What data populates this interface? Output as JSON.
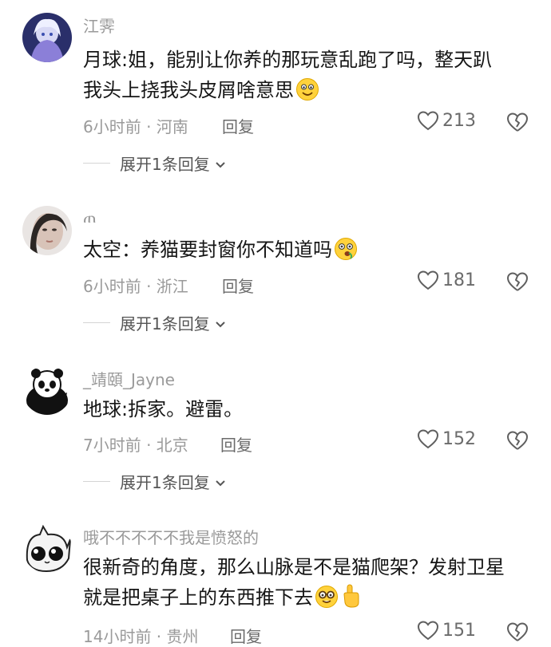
{
  "comments": [
    {
      "username": "江霁",
      "lines": [
        "月球:姐，能别让你养的那玩意乱跑了吗，整天趴",
        "我头上挠我头皮屑啥意思"
      ],
      "emoji": "grinning-face-emoji",
      "time_location": "6小时前 · 河南",
      "reply_label": "回复",
      "likes": "213",
      "expand_label": "展开1条回复"
    },
    {
      "username": "ጠ",
      "lines": [
        "太空：养猫要封窗你不知道吗"
      ],
      "emoji": "zipper-face-emoji",
      "time_location": "6小时前 · 浙江",
      "reply_label": "回复",
      "likes": "181",
      "expand_label": "展开1条回复"
    },
    {
      "username": "_靖頤_Jayne",
      "lines": [
        "地球:拆家。避雷。"
      ],
      "emoji": "",
      "time_location": "7小时前 · 北京",
      "reply_label": "回复",
      "likes": "152",
      "expand_label": "展开1条回复"
    },
    {
      "username": "哦不不不不不我是愤怒的",
      "lines": [
        "很新奇的角度，那么山脉是不是猫爬架？发射卫星",
        "就是把桌子上的东西推下去"
      ],
      "emoji": "nerd-face-and-pointing-up-emoji",
      "time_location": "14小时前 · 贵州",
      "reply_label": "回复",
      "likes": "151",
      "expand_label": ""
    }
  ],
  "colors": {
    "meta": "#9a9a9a",
    "text": "#161616",
    "icon": "#6b6b6b"
  }
}
